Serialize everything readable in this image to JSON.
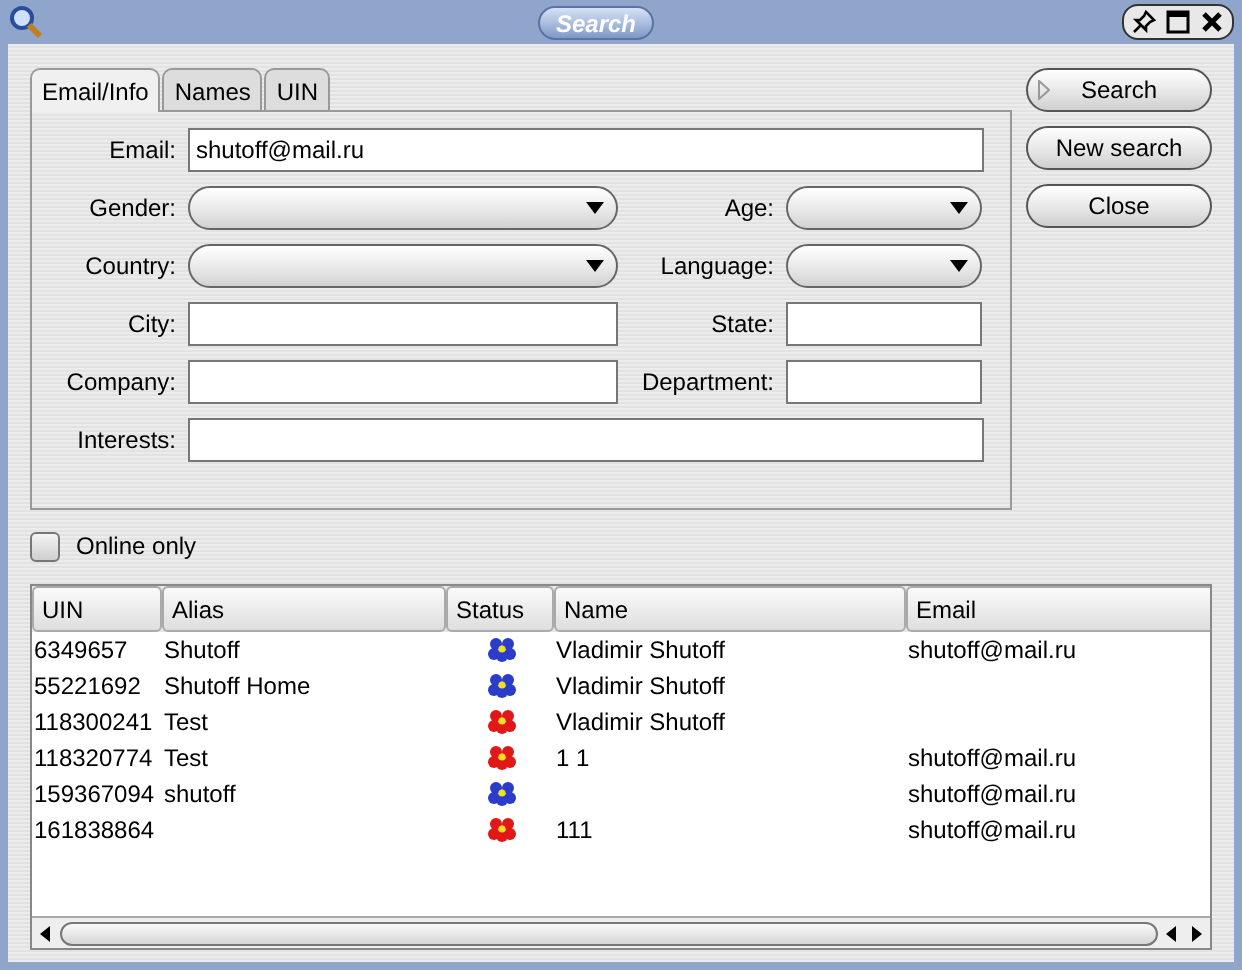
{
  "window": {
    "title": "Search"
  },
  "tabs": [
    {
      "label": "Email/Info",
      "selected": true
    },
    {
      "label": "Names",
      "selected": false
    },
    {
      "label": "UIN",
      "selected": false
    }
  ],
  "form": {
    "rows": [
      [
        {
          "label": "Email:",
          "kind": "text",
          "value": "shutoff@mail.ru"
        }
      ],
      [
        {
          "label": "Gender:",
          "kind": "select"
        },
        {
          "label": "Age:",
          "kind": "select"
        }
      ],
      [
        {
          "label": "Country:",
          "kind": "select"
        },
        {
          "label": "Language:",
          "kind": "select"
        }
      ],
      [
        {
          "label": "City:",
          "kind": "text"
        },
        {
          "label": "State:",
          "kind": "text"
        }
      ],
      [
        {
          "label": "Company:",
          "kind": "text"
        },
        {
          "label": "Department:",
          "kind": "text"
        }
      ],
      [
        {
          "label": "Interests:",
          "kind": "text"
        }
      ]
    ]
  },
  "buttons": [
    {
      "label": "Search",
      "default": true
    },
    {
      "label": "New search",
      "default": false
    },
    {
      "label": "Close",
      "default": false
    }
  ],
  "online_only": {
    "label": "Online only",
    "checked": false
  },
  "table": {
    "columns": [
      "UIN",
      "Alias",
      "Status",
      "Name",
      "Email"
    ],
    "rows": [
      {
        "uin": "6349657",
        "alias": "Shutoff",
        "color": "#2a3cc8",
        "name": "Vladimir Shutoff",
        "email": "shutoff@mail.ru"
      },
      {
        "uin": "55221692",
        "alias": "Shutoff Home",
        "color": "#2a3cc8",
        "name": "Vladimir Shutoff"
      },
      {
        "uin": "118300241",
        "alias": "Test",
        "color": "#e01818",
        "name": "Vladimir Shutoff"
      },
      {
        "uin": "118320774",
        "alias": "Test",
        "color": "#e01818",
        "name": "1 1",
        "email": "shutoff@mail.ru"
      },
      {
        "uin": "159367094",
        "alias": "shutoff",
        "color": "#2a3cc8",
        "email": "shutoff@mail.ru"
      },
      {
        "uin": "161838864",
        "color": "#e01818",
        "name": "111",
        "email": "shutoff@mail.ru"
      }
    ]
  }
}
